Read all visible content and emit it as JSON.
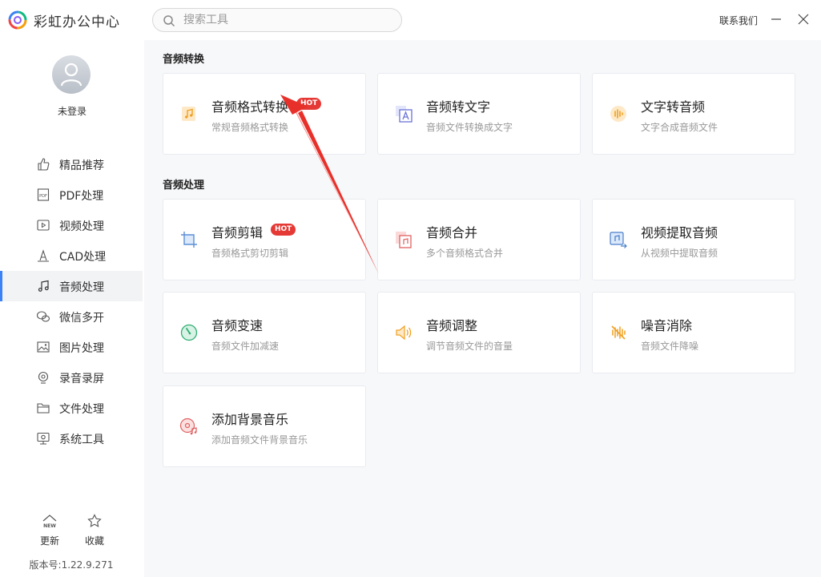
{
  "app": {
    "title": "彩虹办公中心",
    "contact": "联系我们"
  },
  "search": {
    "placeholder": "搜索工具"
  },
  "user": {
    "status": "未登录"
  },
  "sidebar": {
    "items": [
      {
        "label": "精品推荐",
        "icon": "thumbs-up-icon"
      },
      {
        "label": "PDF处理",
        "icon": "pdf-icon"
      },
      {
        "label": "视频处理",
        "icon": "video-play-icon"
      },
      {
        "label": "CAD处理",
        "icon": "cad-icon"
      },
      {
        "label": "音频处理",
        "icon": "music-note-icon",
        "active": true
      },
      {
        "label": "微信多开",
        "icon": "wechat-icon"
      },
      {
        "label": "图片处理",
        "icon": "image-icon"
      },
      {
        "label": "录音录屏",
        "icon": "record-icon"
      },
      {
        "label": "文件处理",
        "icon": "folder-icon"
      },
      {
        "label": "系统工具",
        "icon": "system-icon"
      }
    ],
    "update_label": "更新",
    "favorite_label": "收藏",
    "version": "版本号:1.22.9.271",
    "accent": "#3b82f6"
  },
  "sections": [
    {
      "title": "音频转换",
      "cards": [
        {
          "title": "音频格式转换",
          "desc": "常规音频格式转换",
          "hot": "HOT",
          "icon": "audio-file-icon"
        },
        {
          "title": "音频转文字",
          "desc": "音频文件转换成文字",
          "icon": "text-convert-icon"
        },
        {
          "title": "文字转音频",
          "desc": "文字合成音频文件",
          "icon": "voice-wave-icon"
        }
      ]
    },
    {
      "title": "音频处理",
      "cards": [
        {
          "title": "音频剪辑",
          "desc": "音频格式剪切剪辑",
          "hot": "HOT",
          "icon": "crop-icon"
        },
        {
          "title": "音频合并",
          "desc": "多个音频格式合并",
          "icon": "merge-icon"
        },
        {
          "title": "视频提取音频",
          "desc": "从视频中提取音频",
          "icon": "extract-audio-icon"
        },
        {
          "title": "音频变速",
          "desc": "音频文件加减速",
          "icon": "speed-gauge-icon"
        },
        {
          "title": "音频调整",
          "desc": "调节音频文件的音量",
          "icon": "volume-icon"
        },
        {
          "title": "噪音消除",
          "desc": "音频文件降噪",
          "icon": "noise-cancel-icon"
        },
        {
          "title": "添加背景音乐",
          "desc": "添加音频文件背景音乐",
          "icon": "background-music-icon"
        }
      ]
    }
  ],
  "hot_color": "#e53935"
}
